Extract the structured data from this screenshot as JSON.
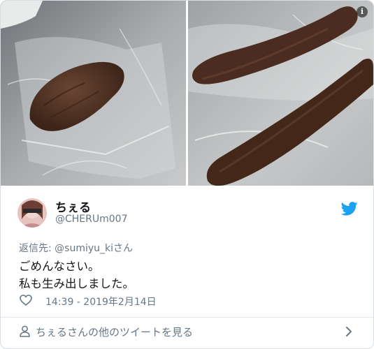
{
  "tweet": {
    "display_name": "ちぇる",
    "handle": "@CHERUm007",
    "reply_prefix": "返信先:",
    "reply_mention": "@sumiyu_kiさん",
    "text_lines": [
      "ごめんなさい。",
      "私も生み出しました。"
    ],
    "timestamp": "14:39 - 2019年2月14日"
  },
  "footer": {
    "label": "ちぇるさんの他のツイートを見る"
  },
  "icons": {
    "info": "info-icon",
    "bird": "twitter-bird-icon",
    "heart": "heart-icon",
    "person": "person-icon",
    "chevron": "chevron-right-icon"
  },
  "colors": {
    "brand": "#1da1f2",
    "muted": "#657786",
    "text": "#14171a",
    "border": "#e1e8ed"
  }
}
